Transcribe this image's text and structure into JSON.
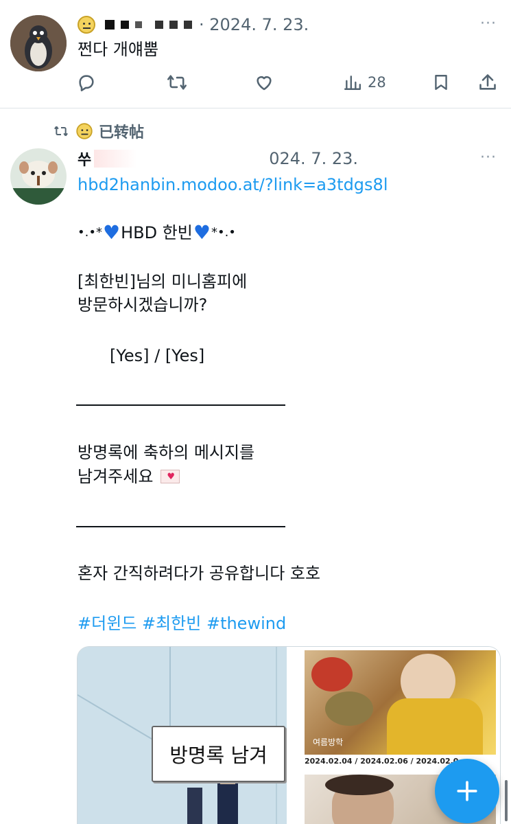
{
  "tweet1": {
    "date": "· 2024. 7. 23.",
    "text": "쩐다 개얘뿜",
    "views": "28"
  },
  "retweet": {
    "label": "已转帖",
    "author_initial": "쑤",
    "date": "024. 7. 23.",
    "link": "hbd2hanbin.modoo.at/?link=a3tdgs8l",
    "line1_left": "•.•*",
    "line1_main": "HBD 한빈",
    "line1_right": "*•.•",
    "line2": "[최한빈]님의 미니홈피에",
    "line3": "방문하시겠습니까?",
    "line4": "[Yes] / [Yes]",
    "line5": "방명록에 축하의 메시지를",
    "line6": "남겨주세요",
    "line7": "혼자 간직하려다가 공유합니다 호호",
    "hashtags": "#더윈드 #최한빈 #thewind"
  },
  "card": {
    "guestbook_label": "방명록 남겨",
    "dates": "2024.02.04 / 2024.02.06 / 2024.02.0",
    "photo_caption": "여름방학"
  },
  "colors": {
    "accent": "#1d9bf0",
    "text": "#0f1419",
    "muted": "#536471"
  },
  "icons": {
    "reply": "reply-icon",
    "retweet": "retweet-icon",
    "like": "heart-icon",
    "views": "views-icon",
    "bookmark": "bookmark-icon",
    "share": "share-icon",
    "compose": "plus-icon"
  }
}
